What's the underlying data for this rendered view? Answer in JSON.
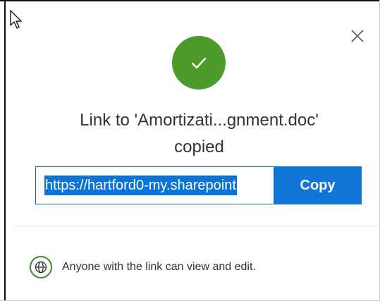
{
  "dialog": {
    "title_line1": "Link to 'Amortizati...gnment.doc'",
    "title_line2": "copied",
    "link_url": "https://hartford0-my.sharepoint",
    "copy_label": "Copy",
    "permission_text": "Anyone with the link can view and edit."
  },
  "colors": {
    "success_green": "#4c9a2a",
    "accent_blue": "#0f75d6",
    "text": "#333333"
  },
  "icons": {
    "cursor": "mouse-pointer-icon",
    "close": "close-icon",
    "success": "checkmark-icon",
    "permission": "globe-icon"
  }
}
